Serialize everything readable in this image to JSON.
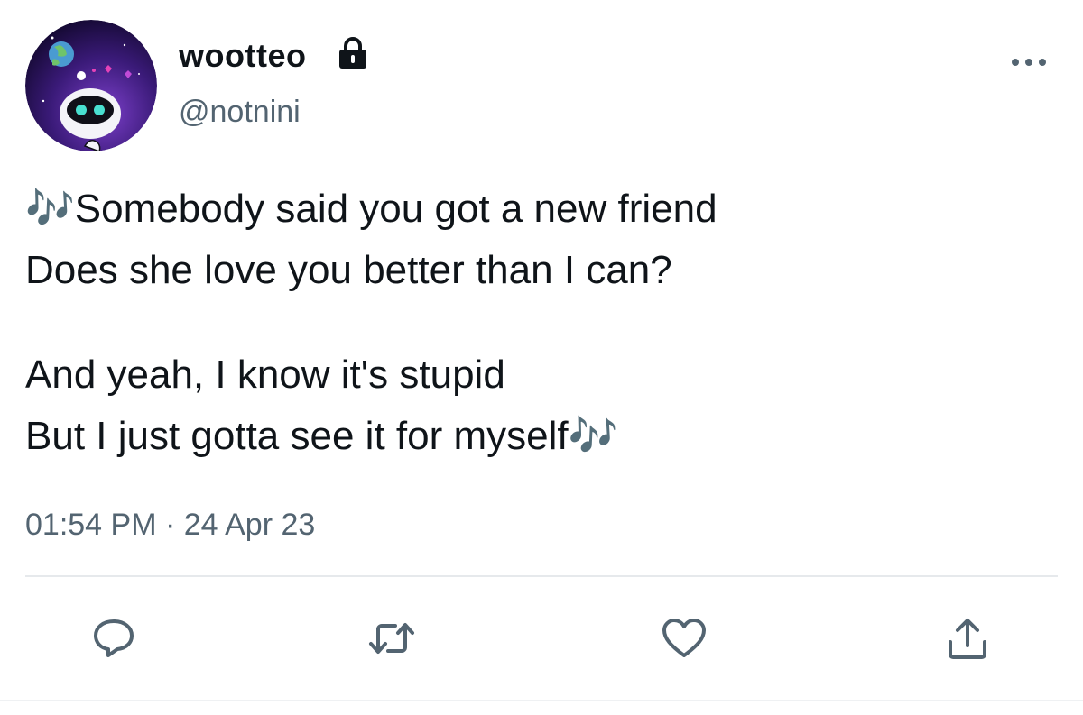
{
  "user": {
    "display_name": "wootteo",
    "handle": "@notnini",
    "avatar_icon": "robot-avatar",
    "verified_icon": "lock-icon"
  },
  "tweet": {
    "lines": [
      "🎶Somebody said you got a new friend",
      "Does she love you better than I can?",
      "And yeah, I know it's stupid",
      "But I just gotta see it for myself🎶"
    ],
    "timestamp": "01:54 PM · 24 Apr 23"
  },
  "actions": {
    "reply_icon": "reply-icon",
    "retweet_icon": "retweet-icon",
    "like_icon": "heart-icon",
    "share_icon": "share-icon",
    "more_icon": "more-icon"
  },
  "colors": {
    "text": "#0f1419",
    "secondary": "#536471",
    "divider": "#e6e9ec"
  }
}
